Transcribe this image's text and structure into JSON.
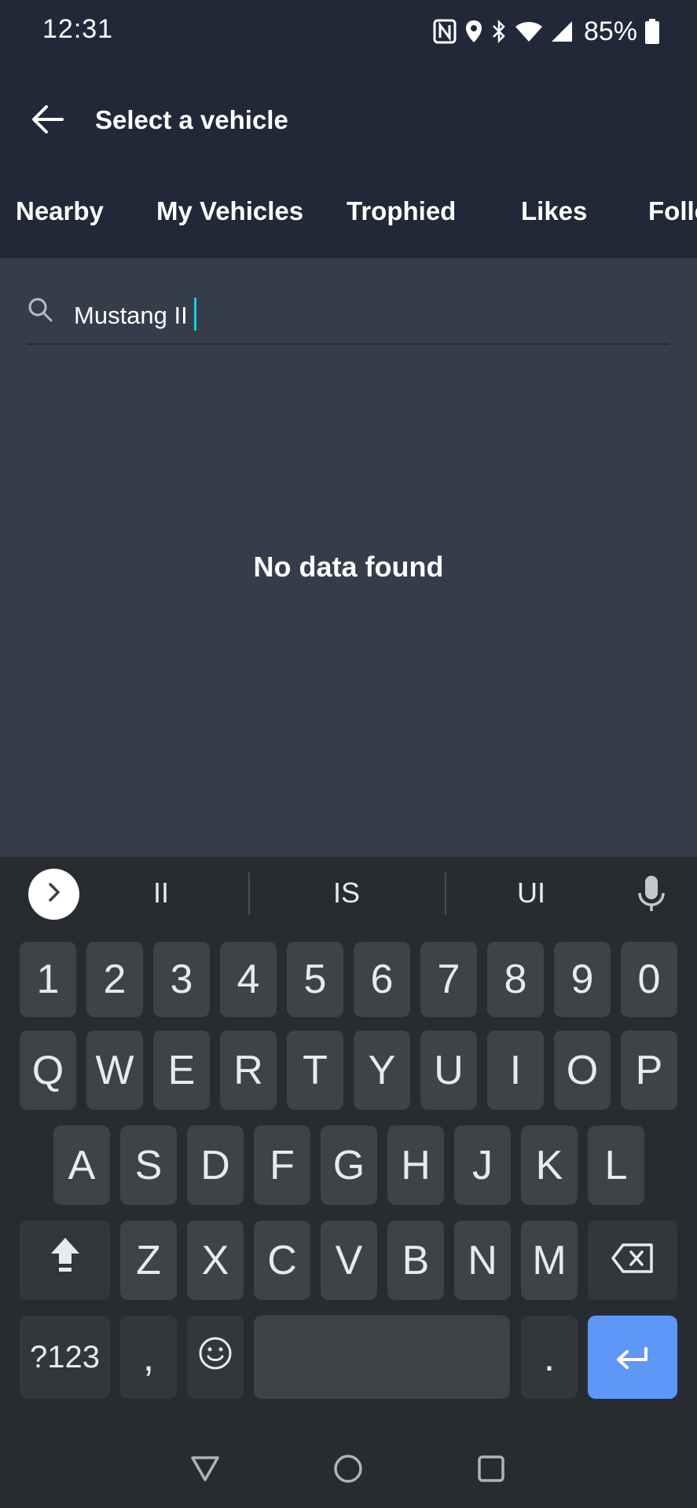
{
  "status_bar": {
    "time": "12:31",
    "battery": "85%",
    "icons": [
      "nfc-icon",
      "location-icon",
      "bluetooth-icon",
      "wifi-icon",
      "signal-icon",
      "battery-icon"
    ]
  },
  "header": {
    "title": "Select a vehicle",
    "back_icon": "arrow-left-icon"
  },
  "tabs": [
    {
      "label": "Nearby"
    },
    {
      "label": "My Vehicles"
    },
    {
      "label": "Trophied"
    },
    {
      "label": "Likes"
    },
    {
      "label": "Follo"
    }
  ],
  "search": {
    "value": "Mustang II",
    "icon": "search-icon"
  },
  "empty_state": {
    "message": "No data found"
  },
  "keyboard": {
    "suggestions": [
      "II",
      "IS",
      "UI"
    ],
    "row_numbers": [
      "1",
      "2",
      "3",
      "4",
      "5",
      "6",
      "7",
      "8",
      "9",
      "0"
    ],
    "row_top": [
      "Q",
      "W",
      "E",
      "R",
      "T",
      "Y",
      "U",
      "I",
      "O",
      "P"
    ],
    "row_middle": [
      "A",
      "S",
      "D",
      "F",
      "G",
      "H",
      "J",
      "K",
      "L"
    ],
    "row_bottom": [
      "Z",
      "X",
      "C",
      "V",
      "B",
      "N",
      "M"
    ],
    "symbols_label": "?123",
    "comma": ",",
    "period": "."
  },
  "colors": {
    "header_bg": "#212938",
    "content_bg": "#363d4a",
    "keyboard_bg": "#282c31",
    "key_bg": "#3f4347",
    "enter_bg": "#5e97f6",
    "caret": "#26c6da"
  }
}
